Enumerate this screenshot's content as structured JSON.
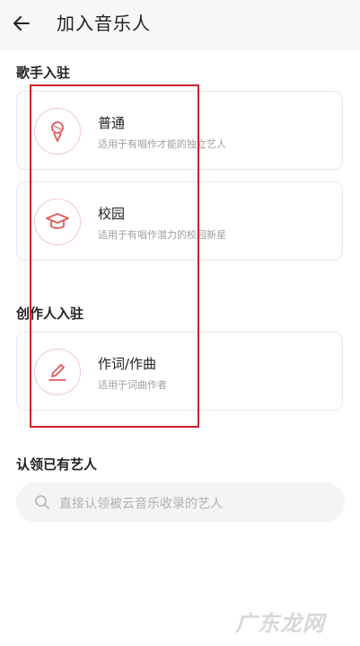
{
  "header": {
    "title": "加入音乐人",
    "back_icon": "arrow-left-icon"
  },
  "sections": {
    "singer_title": "歌手入驻",
    "creator_title": "创作人入驻",
    "claim_title": "认领已有艺人"
  },
  "cards": {
    "normal": {
      "title": "普通",
      "desc": "适用于有唱作才能的独立艺人",
      "icon": "microphone-icon"
    },
    "campus": {
      "title": "校园",
      "desc": "适用于有唱作潜力的校园新星",
      "icon": "graduation-cap-icon"
    },
    "lyric": {
      "title": "作词/作曲",
      "desc": "适用于词曲作者",
      "icon": "pen-icon"
    }
  },
  "search": {
    "placeholder": "直接认领被云音乐收录的艺人",
    "icon": "search-icon"
  },
  "watermark": "广东龙网",
  "colors": {
    "accent": "#e05a5a",
    "highlight": "#d0202a"
  }
}
